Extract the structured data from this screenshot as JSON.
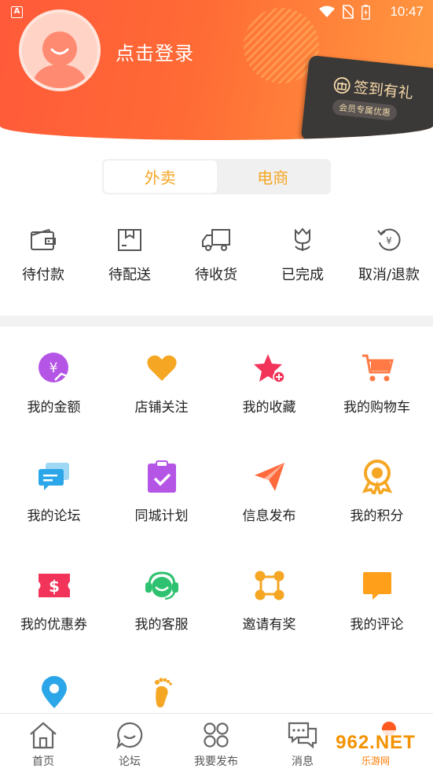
{
  "status_bar": {
    "time": "10:47",
    "app_badge": "A"
  },
  "header": {
    "login_text": "点击登录",
    "signin_title": "签到有礼",
    "signin_sub": "会员专属优惠"
  },
  "segments": [
    {
      "label": "外卖",
      "active": true
    },
    {
      "label": "电商",
      "active": false
    }
  ],
  "orders": [
    {
      "label": "待付款",
      "icon": "wallet-icon"
    },
    {
      "label": "待配送",
      "icon": "package-icon"
    },
    {
      "label": "待收货",
      "icon": "truck-icon"
    },
    {
      "label": "已完成",
      "icon": "tulip-icon"
    },
    {
      "label": "取消/退款",
      "icon": "refund-icon"
    }
  ],
  "services": [
    {
      "label": "我的金额",
      "icon": "yuan-coin-icon",
      "color": "#b455e6"
    },
    {
      "label": "店铺关注",
      "icon": "heart-icon",
      "color": "#f5a623"
    },
    {
      "label": "我的收藏",
      "icon": "star-plus-icon",
      "color": "#f2345a"
    },
    {
      "label": "我的购物车",
      "icon": "cart-icon",
      "color": "#ff7a45"
    },
    {
      "label": "我的论坛",
      "icon": "chat-bubbles-icon",
      "color": "#2ba6e8"
    },
    {
      "label": "同城计划",
      "icon": "clipboard-check-icon",
      "color": "#b455e6"
    },
    {
      "label": "信息发布",
      "icon": "paper-plane-icon",
      "color": "#ff6a3d"
    },
    {
      "label": "我的积分",
      "icon": "medal-icon",
      "color": "#f5a623"
    },
    {
      "label": "我的优惠券",
      "icon": "coupon-icon",
      "color": "#f2345a"
    },
    {
      "label": "我的客服",
      "icon": "headset-icon",
      "color": "#2ec16f"
    },
    {
      "label": "邀请有奖",
      "icon": "nodes-icon",
      "color": "#f5a623"
    },
    {
      "label": "我的评论",
      "icon": "comment-icon",
      "color": "#ff9f1a"
    },
    {
      "label": "",
      "icon": "location-pin-icon",
      "color": "#2ba6e8"
    },
    {
      "label": "",
      "icon": "footprint-icon",
      "color": "#f5a623"
    }
  ],
  "bottom_nav": [
    {
      "label": "首页",
      "icon": "home-icon"
    },
    {
      "label": "论坛",
      "icon": "smile-bubble-icon"
    },
    {
      "label": "我要发布",
      "icon": "grid-icon"
    },
    {
      "label": "消息",
      "icon": "message-icon"
    },
    {
      "label": "",
      "icon": "dot-icon"
    }
  ],
  "watermark": {
    "top": "962.NET",
    "bottom": "乐游网"
  }
}
